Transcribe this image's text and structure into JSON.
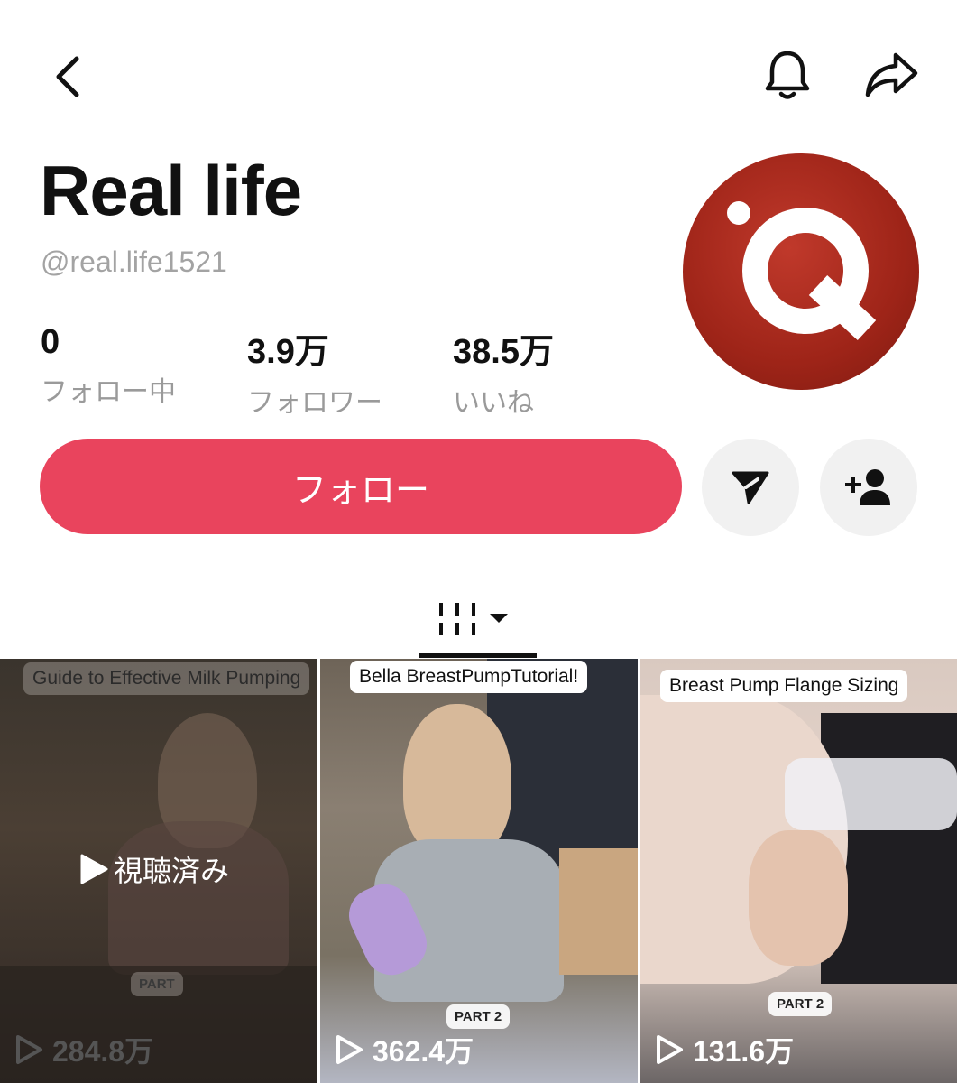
{
  "profile": {
    "name": "Real life",
    "handle": "@real.life1521"
  },
  "stats": [
    {
      "value": "0",
      "label": "フォロー中"
    },
    {
      "value": "3.9万",
      "label": "フォロワー"
    },
    {
      "value": "38.5万",
      "label": "いいね"
    }
  ],
  "actions": {
    "follow_label": "フォロー"
  },
  "icons": {
    "back": "chevron-left-icon",
    "notifications": "bell-icon",
    "share": "share-arrow-icon",
    "message": "send-icon",
    "add_friend": "add-user-icon",
    "videos_tab": "grid-icon"
  },
  "colors": {
    "follow_button": "#e9445d",
    "avatar": "#a52a1d"
  },
  "videos": [
    {
      "caption": "Guide to Effective Milk Pumping",
      "part": "PART",
      "views": "284.8万",
      "overlay": "視聴済み"
    },
    {
      "caption": "Bella BreastPumpTutorial!",
      "part": "PART 2",
      "views": "362.4万"
    },
    {
      "caption": "Breast Pump Flange Sizing",
      "part": "PART 2",
      "views": "131.6万"
    }
  ]
}
